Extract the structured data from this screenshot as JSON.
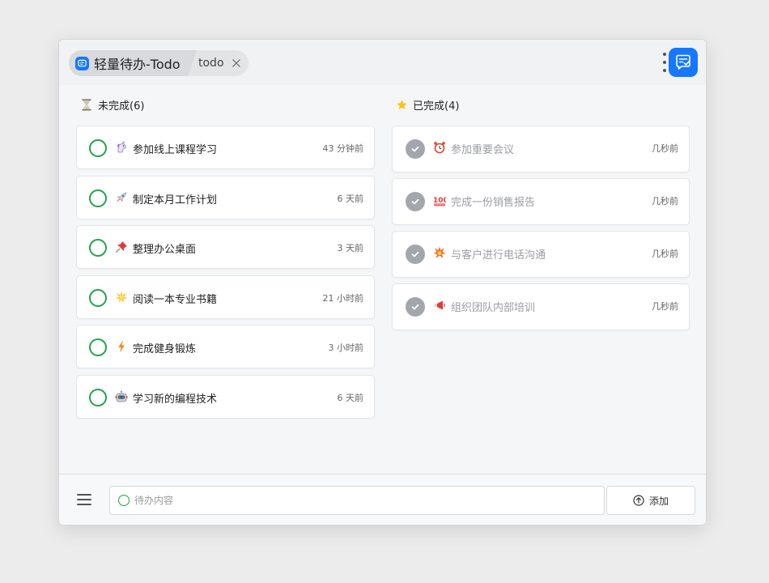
{
  "titlebar": {
    "app_title": "轻量待办-Todo",
    "tab_label": "todo",
    "close_icon": "close-icon",
    "menu_icon": "kebab-menu-icon",
    "brand_icon": "todo-list-check-icon",
    "brand_color": "#1677ff"
  },
  "pending": {
    "header": "未完成(6)",
    "icon": "hourglass-icon",
    "items": [
      {
        "emoji": "🦄",
        "text": "参加线上课程学习",
        "time": "43 分钟前"
      },
      {
        "emoji": "🚀",
        "text": "制定本月工作计划",
        "time": "6 天前"
      },
      {
        "emoji": "📌",
        "text": "整理办公桌面",
        "time": "3 天前"
      },
      {
        "emoji": "🌟",
        "text": "阅读一本专业书籍",
        "time": "21 小时前"
      },
      {
        "emoji": "⚡",
        "text": "完成健身锻炼",
        "time": "3 小时前"
      },
      {
        "emoji": "🤖",
        "text": "学习新的编程技术",
        "time": "6 天前"
      }
    ]
  },
  "completed": {
    "header": "已完成(4)",
    "icon": "star-icon",
    "items": [
      {
        "emoji": "⏰",
        "text": "参加重要会议",
        "time": "几秒前"
      },
      {
        "emoji": "💯",
        "text": "完成一份销售报告",
        "time": "几秒前"
      },
      {
        "emoji": "💥",
        "text": "与客户进行电话沟通",
        "time": "几秒前"
      },
      {
        "emoji": "📢",
        "text": "组织团队内部培训",
        "time": "几秒前"
      }
    ]
  },
  "composer": {
    "placeholder": "待办内容",
    "value": "",
    "add_label": "添加",
    "accent_color": "#22a34a"
  }
}
